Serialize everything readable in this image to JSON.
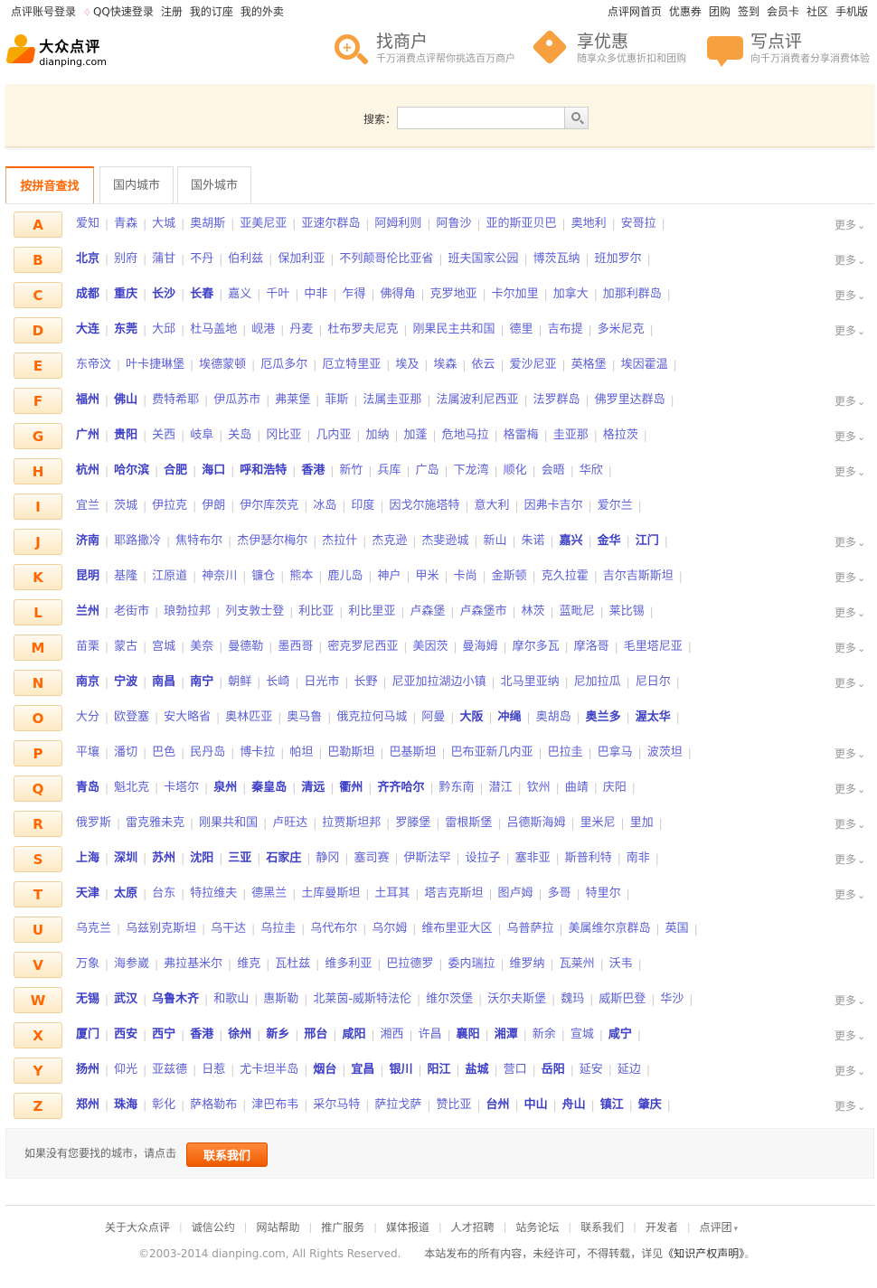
{
  "topbar": {
    "left": [
      "点评账号登录",
      "QQ快速登录",
      "注册",
      "我的订座",
      "我的外卖"
    ],
    "right": [
      "点评网首页",
      "优惠券",
      "团购",
      "签到",
      "会员卡",
      "社区",
      "手机版"
    ]
  },
  "logo": {
    "cn": "大众点评",
    "en": "dianping.com"
  },
  "features": [
    {
      "title": "找商户",
      "desc": "千万消费点评帮你挑选百万商户"
    },
    {
      "title": "享优惠",
      "desc": "随享众多优惠折扣和团购"
    },
    {
      "title": "写点评",
      "desc": "向千万消费者分享消费体验"
    }
  ],
  "search": {
    "label": "搜索：",
    "placeholder": ""
  },
  "tabs": [
    "按拼音查找",
    "国内城市",
    "国外城市"
  ],
  "more_label": "更多",
  "rows": [
    {
      "letter": "A",
      "more": true,
      "cities": [
        [
          "爱知",
          0
        ],
        [
          "青森",
          0
        ],
        [
          "大城",
          0
        ],
        [
          "奥胡斯",
          0
        ],
        [
          "亚美尼亚",
          0
        ],
        [
          "亚速尔群岛",
          0
        ],
        [
          "阿姆利则",
          0
        ],
        [
          "阿鲁沙",
          0
        ],
        [
          "亚的斯亚贝巴",
          0
        ],
        [
          "奥地利",
          0
        ],
        [
          "安哥拉",
          0
        ]
      ]
    },
    {
      "letter": "B",
      "more": true,
      "cities": [
        [
          "北京",
          1
        ],
        [
          "别府",
          0
        ],
        [
          "蒲甘",
          0
        ],
        [
          "不丹",
          0
        ],
        [
          "伯利兹",
          0
        ],
        [
          "保加利亚",
          0
        ],
        [
          "不列颠哥伦比亚省",
          0
        ],
        [
          "班夫国家公园",
          0
        ],
        [
          "博茨瓦纳",
          0
        ],
        [
          "班加罗尔",
          0
        ]
      ]
    },
    {
      "letter": "C",
      "more": true,
      "cities": [
        [
          "成都",
          1
        ],
        [
          "重庆",
          1
        ],
        [
          "长沙",
          1
        ],
        [
          "长春",
          1
        ],
        [
          "嘉义",
          0
        ],
        [
          "千叶",
          0
        ],
        [
          "中非",
          0
        ],
        [
          "乍得",
          0
        ],
        [
          "佛得角",
          0
        ],
        [
          "克罗地亚",
          0
        ],
        [
          "卡尔加里",
          0
        ],
        [
          "加拿大",
          0
        ],
        [
          "加那利群岛",
          0
        ]
      ]
    },
    {
      "letter": "D",
      "more": true,
      "cities": [
        [
          "大连",
          1
        ],
        [
          "东莞",
          1
        ],
        [
          "大邱",
          0
        ],
        [
          "杜马盖地",
          0
        ],
        [
          "岘港",
          0
        ],
        [
          "丹麦",
          0
        ],
        [
          "杜布罗夫尼克",
          0
        ],
        [
          "刚果民主共和国",
          0
        ],
        [
          "德里",
          0
        ],
        [
          "吉布提",
          0
        ],
        [
          "多米尼克",
          0
        ]
      ]
    },
    {
      "letter": "E",
      "more": false,
      "cities": [
        [
          "东帝汶",
          0
        ],
        [
          "叶卡捷琳堡",
          0
        ],
        [
          "埃德蒙顿",
          0
        ],
        [
          "厄瓜多尔",
          0
        ],
        [
          "厄立特里亚",
          0
        ],
        [
          "埃及",
          0
        ],
        [
          "埃森",
          0
        ],
        [
          "依云",
          0
        ],
        [
          "爱沙尼亚",
          0
        ],
        [
          "英格堡",
          0
        ],
        [
          "埃因霍温",
          0
        ]
      ]
    },
    {
      "letter": "F",
      "more": true,
      "cities": [
        [
          "福州",
          1
        ],
        [
          "佛山",
          1
        ],
        [
          "费特希耶",
          0
        ],
        [
          "伊瓜苏市",
          0
        ],
        [
          "弗莱堡",
          0
        ],
        [
          "菲斯",
          0
        ],
        [
          "法属圭亚那",
          0
        ],
        [
          "法属波利尼西亚",
          0
        ],
        [
          "法罗群岛",
          0
        ],
        [
          "佛罗里达群岛",
          0
        ]
      ]
    },
    {
      "letter": "G",
      "more": true,
      "cities": [
        [
          "广州",
          1
        ],
        [
          "贵阳",
          1
        ],
        [
          "关西",
          0
        ],
        [
          "岐阜",
          0
        ],
        [
          "关岛",
          0
        ],
        [
          "冈比亚",
          0
        ],
        [
          "几内亚",
          0
        ],
        [
          "加纳",
          0
        ],
        [
          "加蓬",
          0
        ],
        [
          "危地马拉",
          0
        ],
        [
          "格雷梅",
          0
        ],
        [
          "圭亚那",
          0
        ],
        [
          "格拉茨",
          0
        ]
      ]
    },
    {
      "letter": "H",
      "more": true,
      "cities": [
        [
          "杭州",
          1
        ],
        [
          "哈尔滨",
          1
        ],
        [
          "合肥",
          1
        ],
        [
          "海口",
          1
        ],
        [
          "呼和浩特",
          1
        ],
        [
          "香港",
          1
        ],
        [
          "新竹",
          0
        ],
        [
          "兵库",
          0
        ],
        [
          "广岛",
          0
        ],
        [
          "下龙湾",
          0
        ],
        [
          "顺化",
          0
        ],
        [
          "会晤",
          0
        ],
        [
          "华欣",
          0
        ]
      ]
    },
    {
      "letter": "I",
      "more": false,
      "cities": [
        [
          "宜兰",
          0
        ],
        [
          "茨城",
          0
        ],
        [
          "伊拉克",
          0
        ],
        [
          "伊朗",
          0
        ],
        [
          "伊尔库茨克",
          0
        ],
        [
          "冰岛",
          0
        ],
        [
          "印度",
          0
        ],
        [
          "因戈尔施塔特",
          0
        ],
        [
          "意大利",
          0
        ],
        [
          "因弗卡吉尔",
          0
        ],
        [
          "爱尔兰",
          0
        ]
      ]
    },
    {
      "letter": "J",
      "more": true,
      "cities": [
        [
          "济南",
          1
        ],
        [
          "耶路撒冷",
          0
        ],
        [
          "焦特布尔",
          0
        ],
        [
          "杰伊瑟尔梅尔",
          0
        ],
        [
          "杰拉什",
          0
        ],
        [
          "杰克逊",
          0
        ],
        [
          "杰斐逊城",
          0
        ],
        [
          "新山",
          0
        ],
        [
          "朱诺",
          0
        ],
        [
          "嘉兴",
          1
        ],
        [
          "金华",
          1
        ],
        [
          "江门",
          1
        ]
      ]
    },
    {
      "letter": "K",
      "more": true,
      "cities": [
        [
          "昆明",
          1
        ],
        [
          "基隆",
          0
        ],
        [
          "江原道",
          0
        ],
        [
          "神奈川",
          0
        ],
        [
          "镰仓",
          0
        ],
        [
          "熊本",
          0
        ],
        [
          "鹿儿岛",
          0
        ],
        [
          "神户",
          0
        ],
        [
          "甲米",
          0
        ],
        [
          "卡尚",
          0
        ],
        [
          "金斯顿",
          0
        ],
        [
          "克久拉霍",
          0
        ],
        [
          "吉尔吉斯斯坦",
          0
        ]
      ]
    },
    {
      "letter": "L",
      "more": true,
      "cities": [
        [
          "兰州",
          1
        ],
        [
          "老街市",
          0
        ],
        [
          "琅勃拉邦",
          0
        ],
        [
          "列支敦士登",
          0
        ],
        [
          "利比亚",
          0
        ],
        [
          "利比里亚",
          0
        ],
        [
          "卢森堡",
          0
        ],
        [
          "卢森堡市",
          0
        ],
        [
          "林茨",
          0
        ],
        [
          "蓝毗尼",
          0
        ],
        [
          "莱比锡",
          0
        ]
      ]
    },
    {
      "letter": "M",
      "more": true,
      "cities": [
        [
          "苗栗",
          0
        ],
        [
          "蒙古",
          0
        ],
        [
          "宫城",
          0
        ],
        [
          "美奈",
          0
        ],
        [
          "曼德勒",
          0
        ],
        [
          "墨西哥",
          0
        ],
        [
          "密克罗尼西亚",
          0
        ],
        [
          "美因茨",
          0
        ],
        [
          "曼海姆",
          0
        ],
        [
          "摩尔多瓦",
          0
        ],
        [
          "摩洛哥",
          0
        ],
        [
          "毛里塔尼亚",
          0
        ]
      ]
    },
    {
      "letter": "N",
      "more": true,
      "cities": [
        [
          "南京",
          1
        ],
        [
          "宁波",
          1
        ],
        [
          "南昌",
          1
        ],
        [
          "南宁",
          1
        ],
        [
          "朝鲜",
          0
        ],
        [
          "长崎",
          0
        ],
        [
          "日光市",
          0
        ],
        [
          "长野",
          0
        ],
        [
          "尼亚加拉湖边小镇",
          0
        ],
        [
          "北马里亚纳",
          0
        ],
        [
          "尼加拉瓜",
          0
        ],
        [
          "尼日尔",
          0
        ]
      ]
    },
    {
      "letter": "O",
      "more": false,
      "cities": [
        [
          "大分",
          0
        ],
        [
          "欧登塞",
          0
        ],
        [
          "安大略省",
          0
        ],
        [
          "奥林匹亚",
          0
        ],
        [
          "奥马鲁",
          0
        ],
        [
          "俄克拉何马城",
          0
        ],
        [
          "阿曼",
          0
        ],
        [
          "大阪",
          1
        ],
        [
          "冲绳",
          1
        ],
        [
          "奥胡岛",
          0
        ],
        [
          "奥兰多",
          1
        ],
        [
          "渥太华",
          1
        ]
      ]
    },
    {
      "letter": "P",
      "more": true,
      "cities": [
        [
          "平壤",
          0
        ],
        [
          "潘切",
          0
        ],
        [
          "巴色",
          0
        ],
        [
          "民丹岛",
          0
        ],
        [
          "博卡拉",
          0
        ],
        [
          "帕坦",
          0
        ],
        [
          "巴勒斯坦",
          0
        ],
        [
          "巴基斯坦",
          0
        ],
        [
          "巴布亚新几内亚",
          0
        ],
        [
          "巴拉圭",
          0
        ],
        [
          "巴拿马",
          0
        ],
        [
          "波茨坦",
          0
        ]
      ]
    },
    {
      "letter": "Q",
      "more": true,
      "cities": [
        [
          "青岛",
          1
        ],
        [
          "魁北克",
          0
        ],
        [
          "卡塔尔",
          0
        ],
        [
          "泉州",
          1
        ],
        [
          "秦皇岛",
          1
        ],
        [
          "清远",
          1
        ],
        [
          "衢州",
          1
        ],
        [
          "齐齐哈尔",
          1
        ],
        [
          "黔东南",
          0
        ],
        [
          "潜江",
          0
        ],
        [
          "钦州",
          0
        ],
        [
          "曲靖",
          0
        ],
        [
          "庆阳",
          0
        ]
      ]
    },
    {
      "letter": "R",
      "more": true,
      "cities": [
        [
          "俄罗斯",
          0
        ],
        [
          "雷克雅未克",
          0
        ],
        [
          "刚果共和国",
          0
        ],
        [
          "卢旺达",
          0
        ],
        [
          "拉贾斯坦邦",
          0
        ],
        [
          "罗滕堡",
          0
        ],
        [
          "雷根斯堡",
          0
        ],
        [
          "吕德斯海姆",
          0
        ],
        [
          "里米尼",
          0
        ],
        [
          "里加",
          0
        ]
      ]
    },
    {
      "letter": "S",
      "more": true,
      "cities": [
        [
          "上海",
          1
        ],
        [
          "深圳",
          1
        ],
        [
          "苏州",
          1
        ],
        [
          "沈阳",
          1
        ],
        [
          "三亚",
          1
        ],
        [
          "石家庄",
          1
        ],
        [
          "静冈",
          0
        ],
        [
          "塞司赛",
          0
        ],
        [
          "伊斯法罕",
          0
        ],
        [
          "设拉子",
          0
        ],
        [
          "塞非亚",
          0
        ],
        [
          "斯普利特",
          0
        ],
        [
          "南非",
          0
        ]
      ]
    },
    {
      "letter": "T",
      "more": true,
      "cities": [
        [
          "天津",
          1
        ],
        [
          "太原",
          1
        ],
        [
          "台东",
          0
        ],
        [
          "特拉维夫",
          0
        ],
        [
          "德黑兰",
          0
        ],
        [
          "土库曼斯坦",
          0
        ],
        [
          "土耳其",
          0
        ],
        [
          "塔吉克斯坦",
          0
        ],
        [
          "图卢姆",
          0
        ],
        [
          "多哥",
          0
        ],
        [
          "特里尔",
          0
        ]
      ]
    },
    {
      "letter": "U",
      "more": false,
      "cities": [
        [
          "乌克兰",
          0
        ],
        [
          "乌兹别克斯坦",
          0
        ],
        [
          "乌干达",
          0
        ],
        [
          "乌拉圭",
          0
        ],
        [
          "乌代布尔",
          0
        ],
        [
          "乌尔姆",
          0
        ],
        [
          "维布里亚大区",
          0
        ],
        [
          "乌普萨拉",
          0
        ],
        [
          "美属维尔京群岛",
          0
        ],
        [
          "英国",
          0
        ]
      ]
    },
    {
      "letter": "V",
      "more": false,
      "cities": [
        [
          "万象",
          0
        ],
        [
          "海参崴",
          0
        ],
        [
          "弗拉基米尔",
          0
        ],
        [
          "维克",
          0
        ],
        [
          "瓦杜兹",
          0
        ],
        [
          "维多利亚",
          0
        ],
        [
          "巴拉德罗",
          0
        ],
        [
          "委内瑞拉",
          0
        ],
        [
          "维罗纳",
          0
        ],
        [
          "瓦莱州",
          0
        ],
        [
          "沃韦",
          0
        ]
      ]
    },
    {
      "letter": "W",
      "more": true,
      "cities": [
        [
          "无锡",
          1
        ],
        [
          "武汉",
          1
        ],
        [
          "乌鲁木齐",
          1
        ],
        [
          "和歌山",
          0
        ],
        [
          "惠斯勒",
          0
        ],
        [
          "北莱茵-威斯特法伦",
          0
        ],
        [
          "维尔茨堡",
          0
        ],
        [
          "沃尔夫斯堡",
          0
        ],
        [
          "魏玛",
          0
        ],
        [
          "威斯巴登",
          0
        ],
        [
          "华沙",
          0
        ]
      ]
    },
    {
      "letter": "X",
      "more": true,
      "cities": [
        [
          "厦门",
          1
        ],
        [
          "西安",
          1
        ],
        [
          "西宁",
          1
        ],
        [
          "香港",
          1
        ],
        [
          "徐州",
          1
        ],
        [
          "新乡",
          1
        ],
        [
          "邢台",
          1
        ],
        [
          "咸阳",
          1
        ],
        [
          "湘西",
          0
        ],
        [
          "许昌",
          0
        ],
        [
          "襄阳",
          1
        ],
        [
          "湘潭",
          1
        ],
        [
          "新余",
          0
        ],
        [
          "宣城",
          0
        ],
        [
          "咸宁",
          1
        ]
      ]
    },
    {
      "letter": "Y",
      "more": true,
      "cities": [
        [
          "扬州",
          1
        ],
        [
          "仰光",
          0
        ],
        [
          "亚兹德",
          0
        ],
        [
          "日惹",
          0
        ],
        [
          "尤卡坦半岛",
          0
        ],
        [
          "烟台",
          1
        ],
        [
          "宜昌",
          1
        ],
        [
          "银川",
          1
        ],
        [
          "阳江",
          1
        ],
        [
          "盐城",
          1
        ],
        [
          "营口",
          0
        ],
        [
          "岳阳",
          1
        ],
        [
          "延安",
          0
        ],
        [
          "延边",
          0
        ]
      ]
    },
    {
      "letter": "Z",
      "more": true,
      "cities": [
        [
          "郑州",
          1
        ],
        [
          "珠海",
          1
        ],
        [
          "彰化",
          0
        ],
        [
          "萨格勒布",
          0
        ],
        [
          "津巴布韦",
          0
        ],
        [
          "采尔马特",
          0
        ],
        [
          "萨拉戈萨",
          0
        ],
        [
          "赞比亚",
          0
        ],
        [
          "台州",
          1
        ],
        [
          "中山",
          1
        ],
        [
          "舟山",
          1
        ],
        [
          "镇江",
          1
        ],
        [
          "肇庆",
          1
        ]
      ]
    }
  ],
  "contact": {
    "message": "如果没有您要找的城市，请点击",
    "button": "联系我们"
  },
  "footer": {
    "links": [
      "关于大众点评",
      "诚信公约",
      "网站帮助",
      "推广服务",
      "媒体报道",
      "人才招聘",
      "站务论坛",
      "联系我们",
      "开发者",
      "点评团"
    ],
    "copyright": "©2003-2014 dianping.com, All Rights Reserved.",
    "statement": "本站发布的所有内容，未经许可，不得转载，详见",
    "statement_link": "《知识产权声明》",
    "statement_end": "。"
  }
}
